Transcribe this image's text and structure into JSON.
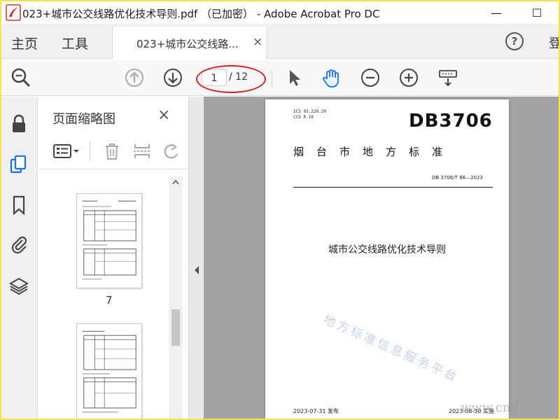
{
  "window": {
    "title": "023+城市公交线路优化技术导则.pdf （已加密） - Adobe Acrobat Pro DC",
    "minimize": "—",
    "maximize": "☐"
  },
  "nav": {
    "home": "主页",
    "tools": "工具",
    "doc_tab": "023+城市公交线路...",
    "doc_tab_close": "×",
    "help": "?",
    "login": "登"
  },
  "toolbar": {
    "page_current": "1",
    "page_total": "/ 12"
  },
  "panel": {
    "title": "页面缩略图",
    "close": "×",
    "thumb_label": "7"
  },
  "document": {
    "ics": "ICS 03.220.20",
    "ccs": "CCS R 10",
    "db_code": "DB3706",
    "local_std": "烟台市地方标准",
    "std_no": "DB 3706/T 88—2023",
    "title": "城市公交线路优化技术导则",
    "issue_date": "2023-07-31 发布",
    "impl_date": "2023-08-30 实施",
    "watermark": "地方标准信息服务平台"
  },
  "overlay": {
    "url_fragment": "www.cnd"
  },
  "colors": {
    "frame": "#f5e34a",
    "accent_blue": "#1473e6",
    "highlight_ring": "#d42020",
    "doc_bg": "#a3a3a3"
  }
}
